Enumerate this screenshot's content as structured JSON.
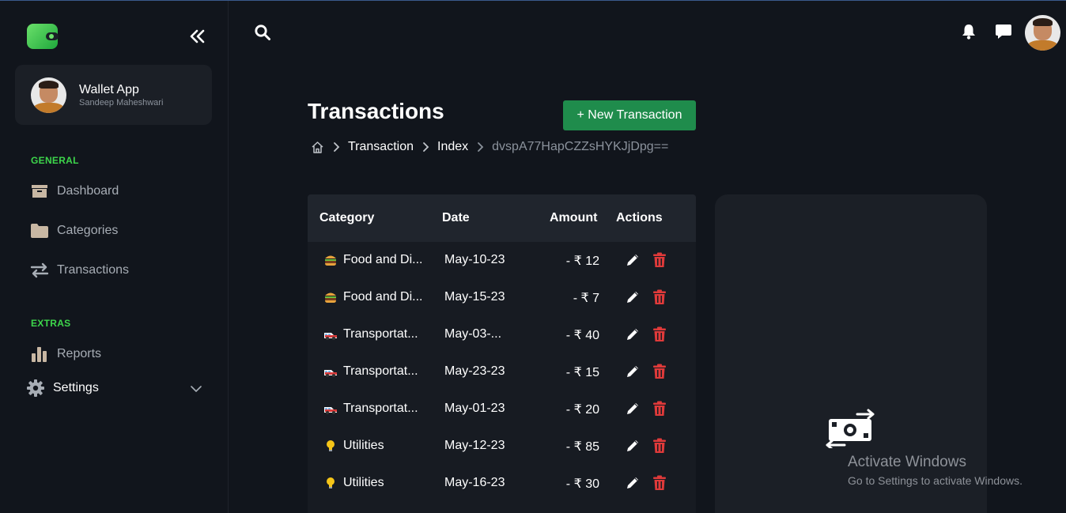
{
  "sidebar": {
    "profile": {
      "name": "Wallet App",
      "subtitle": "Sandeep Maheshwari"
    },
    "sections": [
      {
        "label": "GENERAL"
      },
      {
        "label": "EXTRAS"
      }
    ],
    "items": [
      {
        "label": "Dashboard",
        "icon": "box-icon"
      },
      {
        "label": "Categories",
        "icon": "folder-icon"
      },
      {
        "label": "Transactions",
        "icon": "arrows-swap-icon"
      },
      {
        "label": "Reports",
        "icon": "bar-chart-icon"
      },
      {
        "label": "Settings",
        "icon": "gear-icon"
      }
    ]
  },
  "main": {
    "title": "Transactions",
    "new_button": "+ New Transaction",
    "breadcrumb": [
      "Transaction",
      "Index",
      "dvspA77HapCZZsHYKJjDpg=="
    ],
    "table": {
      "headers": [
        "Category",
        "Date",
        "Amount",
        "Actions"
      ],
      "rows": [
        {
          "icon": "burger-icon",
          "category": "Food and Di...",
          "date": "May-10-23",
          "amount": "- ₹ 12"
        },
        {
          "icon": "burger-icon",
          "category": "Food and Di...",
          "date": "May-15-23",
          "amount": "- ₹ 7"
        },
        {
          "icon": "car-icon",
          "category": "Transportat...",
          "date": "May-03-...",
          "amount": "- ₹ 40"
        },
        {
          "icon": "car-icon",
          "category": "Transportat...",
          "date": "May-23-23",
          "amount": "- ₹ 15"
        },
        {
          "icon": "car-icon",
          "category": "Transportat...",
          "date": "May-01-23",
          "amount": "- ₹ 20"
        },
        {
          "icon": "lightbulb-icon",
          "category": "Utilities",
          "date": "May-12-23",
          "amount": "- ₹ 85"
        },
        {
          "icon": "lightbulb-icon",
          "category": "Utilities",
          "date": "May-16-23",
          "amount": "- ₹ 30"
        }
      ]
    }
  },
  "watermark": {
    "title": "Activate Windows",
    "subtitle": "Go to Settings to activate Windows."
  },
  "colors": {
    "background": "#11151c",
    "accent_green": "#3dd64b",
    "button_green": "#1f8c4c",
    "delete_red": "#e03a3a"
  }
}
